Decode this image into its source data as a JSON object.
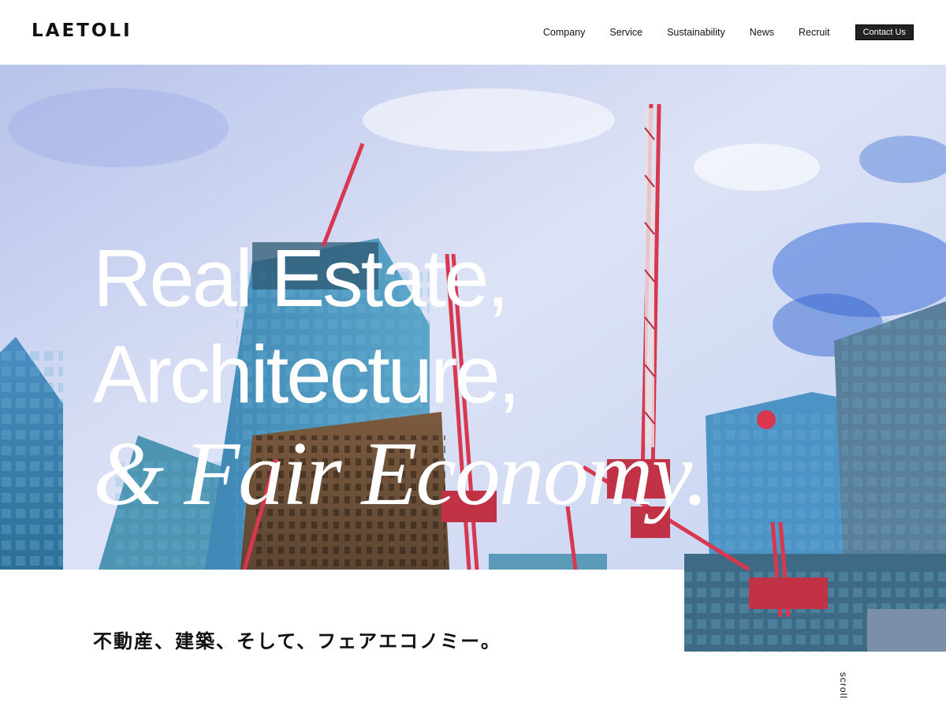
{
  "header": {
    "logo": "LAETOLI",
    "nav": [
      "Company",
      "Service",
      "Sustainability",
      "News",
      "Recruit"
    ],
    "contact_label": "Contact Us"
  },
  "hero": {
    "line1": "Real Estate,",
    "line2": "Architecture,",
    "line3": "& Fair Economy.",
    "background_image": "construction-cranes-skyscrapers-photo"
  },
  "tagline": "不動産、建築、そして、フェアエコノミー。",
  "scroll_label": "scroll",
  "colors": {
    "contact_bg": "#222222",
    "headline": "#ffffff",
    "crane_red": "#d8374f",
    "sky": "#c9d6f2"
  }
}
